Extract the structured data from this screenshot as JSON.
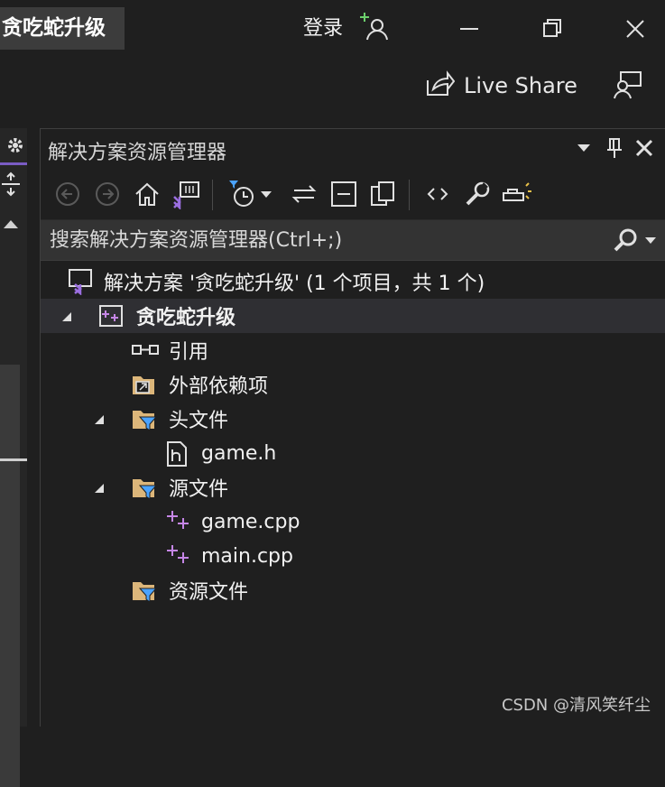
{
  "titlebar": {
    "project_name": "贪吃蛇升级",
    "login_label": "登录",
    "live_share_label": "Live Share"
  },
  "solution_explorer": {
    "title": "解决方案资源管理器",
    "search_placeholder": "搜索解决方案资源管理器(Ctrl+;)",
    "tree": {
      "solution_label": "解决方案 '贪吃蛇升级' (1 个项目，共 1 个)",
      "project_label": "贪吃蛇升级",
      "items": [
        {
          "label": "引用",
          "icon": "references-icon"
        },
        {
          "label": "外部依赖项",
          "icon": "external-dependencies-icon"
        },
        {
          "label": "头文件",
          "icon": "filter-folder-icon"
        },
        {
          "label": "game.h",
          "icon": "header-file-icon"
        },
        {
          "label": "源文件",
          "icon": "filter-folder-icon"
        },
        {
          "label": "game.cpp",
          "icon": "cpp-file-icon"
        },
        {
          "label": "main.cpp",
          "icon": "cpp-file-icon"
        },
        {
          "label": "资源文件",
          "icon": "filter-folder-icon"
        }
      ]
    }
  },
  "watermark": "CSDN @清风笑纤尘",
  "colors": {
    "accent_purple": "#7a5cc4",
    "cpp_pink": "#c586e6",
    "folder_yellow": "#dcb67a",
    "filter_blue": "#4aa3ff"
  }
}
